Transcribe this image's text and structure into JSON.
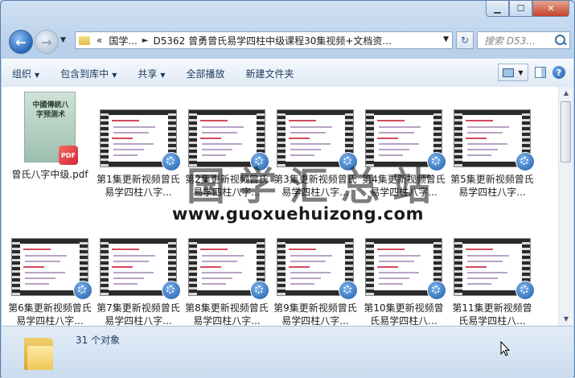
{
  "window": {
    "minimize": "▁",
    "maximize": "☐",
    "close": "✕"
  },
  "address": {
    "chevron": "«",
    "crumbs": [
      "国学...",
      "D5362 曾勇曾氏易学四柱中级课程30集视频+文档资..."
    ],
    "dropdown": "▼"
  },
  "search": {
    "placeholder": "搜索 D53..."
  },
  "toolbar": {
    "organize": "组织",
    "include_library": "包含到库中",
    "share": "共享",
    "play_all": "全部播放",
    "new_folder": "新建文件夹"
  },
  "files": [
    {
      "name": "曾氏八字中级.pdf",
      "type": "pdf",
      "cover_title": "中國傳統八字预测术"
    },
    {
      "name": "第1集更新视频曾氏易学四柱八字...",
      "type": "video"
    },
    {
      "name": "第2集更新视频曾氏易学四柱八字...",
      "type": "video"
    },
    {
      "name": "第3集更新视频曾氏易学四柱八字...",
      "type": "video"
    },
    {
      "name": "第4集更新视频曾氏易学四柱八字...",
      "type": "video"
    },
    {
      "name": "第5集更新视频曾氏易学四柱八字...",
      "type": "video"
    },
    {
      "name": "第6集更新视频曾氏易学四柱八字...",
      "type": "video"
    },
    {
      "name": "第7集更新视频曾氏易学四柱八字...",
      "type": "video"
    },
    {
      "name": "第8集更新视频曾氏易学四柱八字...",
      "type": "video"
    },
    {
      "name": "第9集更新视频曾氏易学四柱八字...",
      "type": "video"
    },
    {
      "name": "第10集更新视频曾氏易学四柱八...",
      "type": "video"
    },
    {
      "name": "第11集更新视频曾氏易学四柱八...",
      "type": "video"
    }
  ],
  "watermark": {
    "text": "国学汇总站",
    "url": "www.guoxuehuizong.com"
  },
  "status": {
    "count": "31 个对象"
  },
  "pdf_badge": "PDF"
}
